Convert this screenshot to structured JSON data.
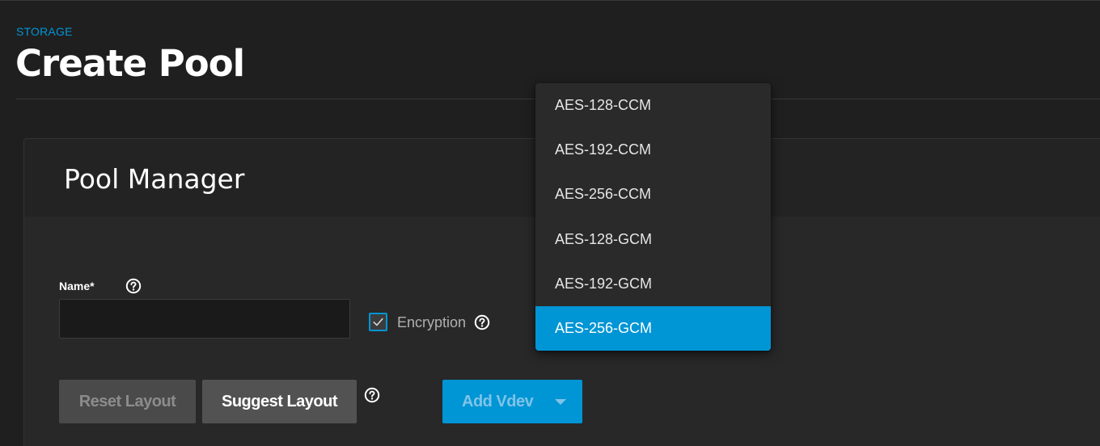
{
  "breadcrumb": "STORAGE",
  "page_title": "Create Pool",
  "card": {
    "title": "Pool Manager"
  },
  "form": {
    "name_label": "Name*",
    "name_value": "",
    "encryption_label": "Encryption",
    "encryption_checked": true
  },
  "buttons": {
    "reset_layout": "Reset Layout",
    "suggest_layout": "Suggest Layout",
    "add_vdev": "Add Vdev"
  },
  "encryption_dropdown": {
    "options": [
      {
        "label": "AES-128-CCM",
        "selected": false
      },
      {
        "label": "AES-192-CCM",
        "selected": false
      },
      {
        "label": "AES-256-CCM",
        "selected": false
      },
      {
        "label": "AES-128-GCM",
        "selected": false
      },
      {
        "label": "AES-192-GCM",
        "selected": false
      },
      {
        "label": "AES-256-GCM",
        "selected": true
      }
    ]
  },
  "colors": {
    "accent": "#0095d5",
    "background": "#1f1f1f",
    "card": "#282828"
  },
  "icons": {
    "help": "help-circle-icon",
    "check": "check-icon",
    "caret": "caret-down-icon"
  }
}
